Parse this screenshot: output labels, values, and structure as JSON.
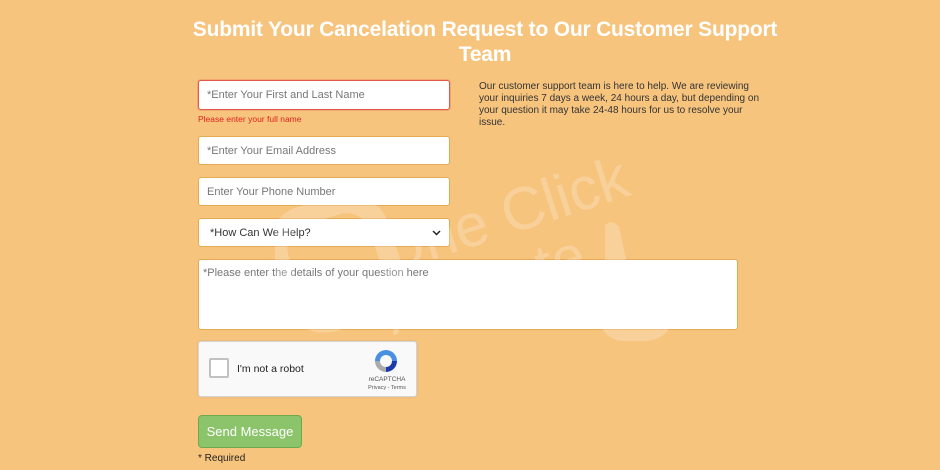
{
  "page": {
    "title": "Submit Your Cancelation Request to Our Customer Support Team"
  },
  "form": {
    "name_placeholder": "*Enter Your First and Last Name",
    "name_error": "Please enter your full name",
    "email_placeholder": "*Enter Your Email Address",
    "phone_placeholder": "Enter Your Phone Number",
    "help_select": {
      "selected": "*How Can We Help?"
    },
    "details_placeholder": "*Please enter the details of your question here",
    "recaptcha": {
      "label": "I'm not a robot",
      "brand": "reCAPTCHA",
      "links": "Privacy - Terms"
    },
    "send_label": "Send Message",
    "required_note": "* Required"
  },
  "info": {
    "text": "Our customer support team is here to help. We are reviewing your inquiries 7 days a week, 24 hours a day, but depending on your question it may take 24-48 hours for us to resolve your issue."
  },
  "watermark": {
    "line1": "One Click",
    "line2": "Activate"
  },
  "colors": {
    "background": "#f7c47e",
    "field_border": "#e3ac54",
    "error": "#e0251c",
    "button": "#8cc46b"
  }
}
